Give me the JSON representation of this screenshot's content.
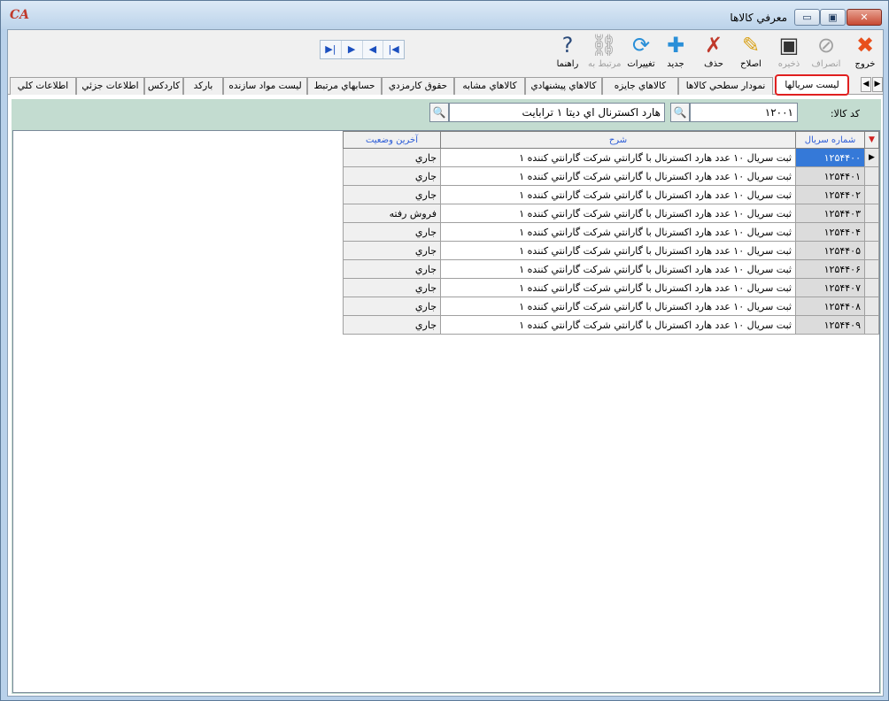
{
  "window": {
    "logo_text": "CA",
    "title": "معرفي کالاها",
    "min_glyph": "▭",
    "max_glyph": "▣",
    "close_glyph": "✕"
  },
  "toolbar": {
    "exit": {
      "label": "خروج",
      "icon": "x-icon",
      "glyph": "✖"
    },
    "cancel": {
      "label": "انصراف",
      "icon": "cancel-icon",
      "glyph": "⊘"
    },
    "save": {
      "label": "ذخيره",
      "icon": "save-disk-icon",
      "glyph": "▣"
    },
    "edit": {
      "label": "اصلاح",
      "icon": "pencil-icon",
      "glyph": "✎"
    },
    "delete": {
      "label": "حذف",
      "icon": "delete-document-icon",
      "glyph": "✗"
    },
    "new": {
      "label": "جديد",
      "icon": "new-document-icon",
      "glyph": "✚"
    },
    "changes": {
      "label": "تغييرات",
      "icon": "refresh-icon",
      "glyph": "⟳"
    },
    "related": {
      "label": "مرتبط به",
      "icon": "link-icon",
      "glyph": "⛓"
    },
    "help": {
      "label": "راهنما",
      "icon": "question-icon",
      "glyph": "?"
    }
  },
  "navigator": {
    "last": "▶|",
    "next": "▶",
    "prev": "◀",
    "first": "|◀"
  },
  "tabs": [
    {
      "label": "ليست سريالها",
      "active": true
    },
    {
      "label": "نمودار سطحي کالاها"
    },
    {
      "label": "کالاهاي جايزه"
    },
    {
      "label": "کالاهاي پيشنهادي"
    },
    {
      "label": "کالاهاي مشابه"
    },
    {
      "label": "حقوق کارمزدي"
    },
    {
      "label": "حسابهاي مرتبط"
    },
    {
      "label": "ليست مواد سازنده"
    },
    {
      "label": "بارکد"
    },
    {
      "label": "کاردکس"
    },
    {
      "label": "اطلاعات جزئي"
    },
    {
      "label": "اطلاعات کلي"
    }
  ],
  "tab_scroll": {
    "left": "◀",
    "right": "▶"
  },
  "filter": {
    "code_label": "کد کالا:",
    "code_value": "۱۲۰۰۱",
    "name_value": "هارد اکسترنال اي ديتا ۱ ترابايت",
    "search_glyph": "🔍"
  },
  "grid": {
    "filter_glyph": "▼",
    "row_pointer": "▶",
    "columns": {
      "serial": "شماره سريال",
      "description": "شرح",
      "last_status": "آخرين وضعيت"
    },
    "rows": [
      {
        "serial": "۱۲۵۴۴۰۰",
        "description": "ثبت سريال ۱۰ عدد هارد اکسترنال با گارانتي شرکت گارانتي کننده ۱",
        "status": "جاري",
        "selected": true
      },
      {
        "serial": "۱۲۵۴۴۰۱",
        "description": "ثبت سريال ۱۰ عدد هارد اکسترنال با گارانتي شرکت گارانتي کننده ۱",
        "status": "جاري"
      },
      {
        "serial": "۱۲۵۴۴۰۲",
        "description": "ثبت سريال ۱۰ عدد هارد اکسترنال با گارانتي شرکت گارانتي کننده ۱",
        "status": "جاري"
      },
      {
        "serial": "۱۲۵۴۴۰۳",
        "description": "ثبت سريال ۱۰ عدد هارد اکسترنال با گارانتي شرکت گارانتي کننده ۱",
        "status": "فروش رفته"
      },
      {
        "serial": "۱۲۵۴۴۰۴",
        "description": "ثبت سريال ۱۰ عدد هارد اکسترنال با گارانتي شرکت گارانتي کننده ۱",
        "status": "جاري"
      },
      {
        "serial": "۱۲۵۴۴۰۵",
        "description": "ثبت سريال ۱۰ عدد هارد اکسترنال با گارانتي شرکت گارانتي کننده ۱",
        "status": "جاري"
      },
      {
        "serial": "۱۲۵۴۴۰۶",
        "description": "ثبت سريال ۱۰ عدد هارد اکسترنال با گارانتي شرکت گارانتي کننده ۱",
        "status": "جاري"
      },
      {
        "serial": "۱۲۵۴۴۰۷",
        "description": "ثبت سريال ۱۰ عدد هارد اکسترنال با گارانتي شرکت گارانتي کننده ۱",
        "status": "جاري"
      },
      {
        "serial": "۱۲۵۴۴۰۸",
        "description": "ثبت سريال ۱۰ عدد هارد اکسترنال با گارانتي شرکت گارانتي کننده ۱",
        "status": "جاري"
      },
      {
        "serial": "۱۲۵۴۴۰۹",
        "description": "ثبت سريال ۱۰ عدد هارد اکسترنال با گارانتي شرکت گارانتي کننده ۱",
        "status": "جاري"
      }
    ]
  },
  "colors": {
    "selected_row": "#3579d8",
    "panel_bg": "#c3dcd0",
    "active_tab_outline": "#e02020"
  }
}
